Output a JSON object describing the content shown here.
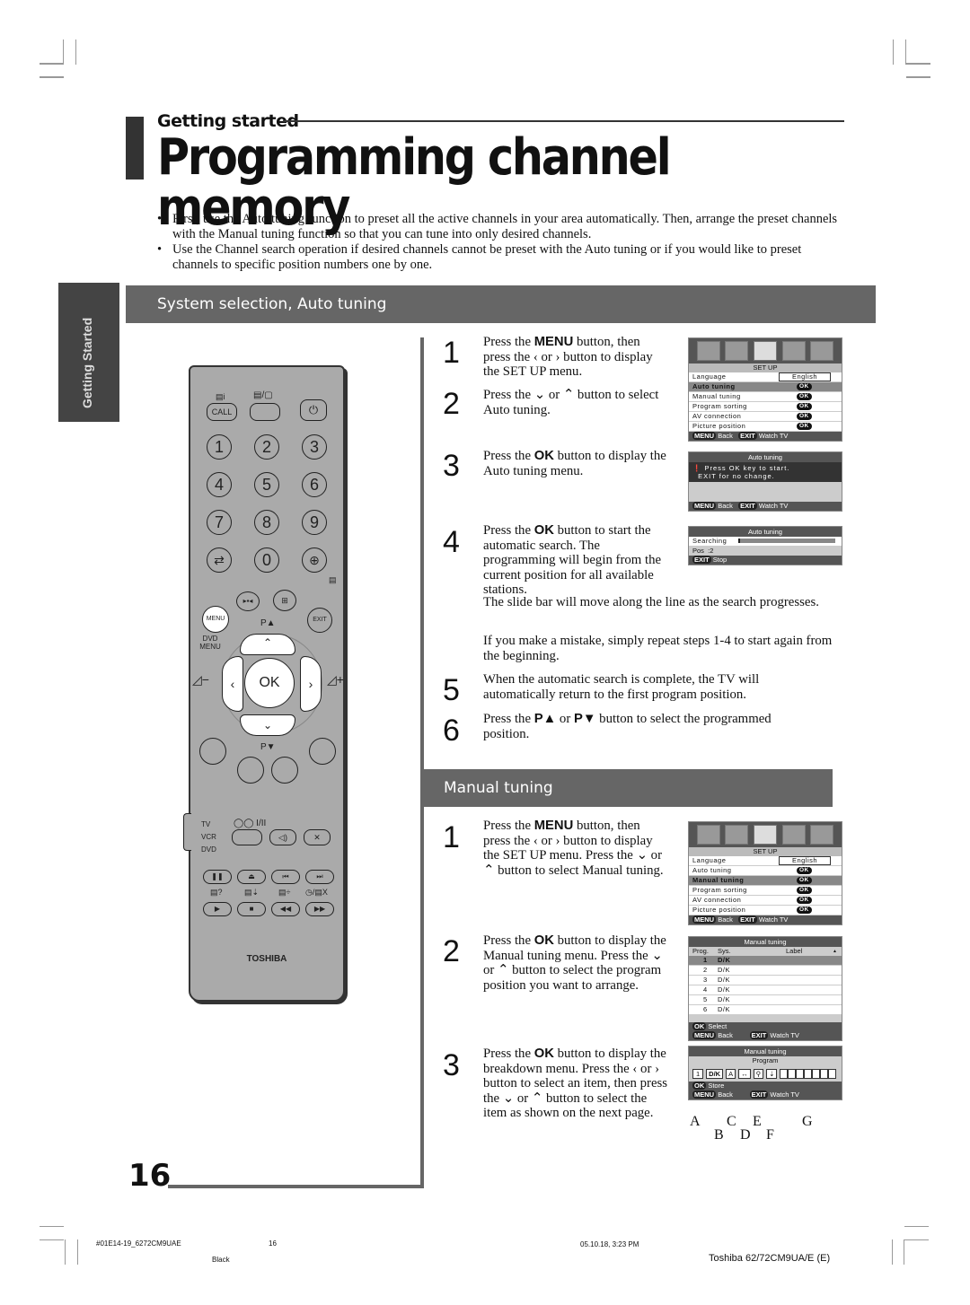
{
  "header": {
    "section_label": "Getting started",
    "page_title": "Programming channel memory"
  },
  "intro_bullets": [
    "First, use the Auto tuning function to preset all the active channels in your area automatically. Then, arrange the preset channels with the Manual tuning function so that you can tune into only desired channels.",
    "Use the Channel search operation if desired channels cannot be preset with the Auto tuning or if you would like to preset channels to specific position numbers one by one."
  ],
  "side_tab": "Getting Started",
  "auto_section": {
    "heading": "System selection, Auto tuning",
    "steps": [
      {
        "num": "1",
        "pre": "Press the ",
        "bold": "MENU",
        "post": " button, then press the ‹ or › button to display the SET UP menu."
      },
      {
        "num": "2",
        "text": "Press the ⌄ or ⌃ button to select Auto tuning."
      },
      {
        "num": "3",
        "pre": "Press the ",
        "bold": "OK",
        "post": " button to display the Auto tuning menu."
      },
      {
        "num": "4",
        "pre": "Press the ",
        "bold": "OK",
        "post": " button to start the automatic search. The programming will begin from the current position for all available stations.",
        "extra1": "The slide bar will move along the line as the search progresses.",
        "extra2": "If you make a mistake, simply repeat steps 1-4 to start again from the beginning."
      },
      {
        "num": "5",
        "text": "When the automatic search is complete, the TV will automatically return to the first program position."
      },
      {
        "num": "6",
        "pre": "Press the ",
        "bold": "P▲",
        "mid": " or ",
        "bold2": "P▼",
        "post": " button to select the programmed position."
      }
    ]
  },
  "manual_section": {
    "heading": "Manual tuning",
    "steps": [
      {
        "num": "1",
        "pre": "Press the ",
        "bold": "MENU",
        "post": " button, then press the ‹ or › button to display the SET UP menu. Press the ⌄ or ⌃ button to select Manual tuning."
      },
      {
        "num": "2",
        "pre": "Press the ",
        "bold": "OK",
        "post": " button to display the Manual tuning menu. Press the ⌄ or ⌃ button to select the program position you want to arrange."
      },
      {
        "num": "3",
        "pre": "Press the ",
        "bold": "OK",
        "post": " button to display the breakdown menu. Press the ‹ or › button to select an item, then press the ⌄ or ⌃ button to select the item as shown on the next page."
      }
    ]
  },
  "osd_setup": {
    "title": "SET UP",
    "rows": [
      {
        "label": "Language",
        "value": "English"
      },
      {
        "label": "Auto tuning",
        "value": "OK"
      },
      {
        "label": "Manual tuning",
        "value": "OK"
      },
      {
        "label": "Program sorting",
        "value": "OK"
      },
      {
        "label": "AV connection",
        "value": "OK"
      },
      {
        "label": "Picture position",
        "value": "OK"
      }
    ],
    "footer_back_key": "MENU",
    "footer_back": "Back",
    "footer_watch_key": "EXIT",
    "footer_watch": "Watch TV"
  },
  "osd_auto_prompt": {
    "title": "Auto tuning",
    "line1": "Press OK key to start.",
    "line2": "EXIT for no change."
  },
  "osd_auto_search": {
    "title": "Auto tuning",
    "searching_label": "Searching",
    "progress": 0.02,
    "pos_label": "Pos",
    "pos_value": ":2",
    "stop_key": "EXIT",
    "stop_label": "Stop"
  },
  "osd_manual": {
    "title": "Manual tuning",
    "columns": [
      "Prog.",
      "Sys.",
      "Label"
    ],
    "rows": [
      {
        "prog": "1",
        "sys": "D/K"
      },
      {
        "prog": "2",
        "sys": "D/K"
      },
      {
        "prog": "3",
        "sys": "D/K"
      },
      {
        "prog": "4",
        "sys": "D/K"
      },
      {
        "prog": "5",
        "sys": "D/K"
      },
      {
        "prog": "6",
        "sys": "D/K"
      }
    ],
    "select_key": "OK",
    "select_label": "Select"
  },
  "osd_program": {
    "title": "Manual tuning",
    "subtitle": "Program",
    "position": "1",
    "system": "D/K",
    "color": "A",
    "store_key": "OK",
    "store_label": "Store",
    "markers": [
      "A",
      "B",
      "C",
      "D",
      "E",
      "F",
      "G"
    ]
  },
  "remote": {
    "call": "CALL",
    "digits": [
      "1",
      "2",
      "3",
      "4",
      "5",
      "6",
      "7",
      "8",
      "9",
      "0"
    ],
    "menu": "MENU",
    "exit": "EXIT",
    "p_up": "P▲",
    "p_down": "P▼",
    "dvd_menu": "DVD MENU",
    "ok": "OK",
    "switch": [
      "TV",
      "VCR",
      "DVD"
    ],
    "audio_label": "I/II",
    "brand": "TOSHIBA"
  },
  "footer": {
    "page_number": "16",
    "file_code": "#01E14-19_6272CM9UAE",
    "file_page": "16",
    "color_plate": "Black",
    "timestamp": "05.10.18, 3:23 PM",
    "model": "Toshiba 62/72CM9UA/E (E)"
  }
}
